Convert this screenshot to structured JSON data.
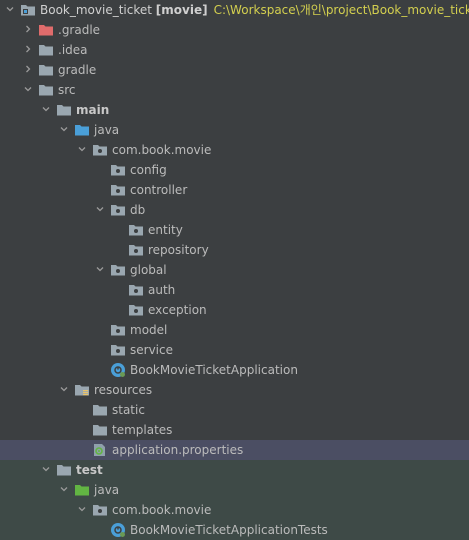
{
  "root": {
    "name": "Book_movie_ticket",
    "module": "[movie]",
    "path": "C:\\Workspace\\개인\\project\\Book_movie_ticket"
  },
  "items": [
    {
      "label": ".gradle",
      "level": 1,
      "chevron": "right",
      "icon": "folder-red-icon"
    },
    {
      "label": ".idea",
      "level": 1,
      "chevron": "right",
      "icon": "folder-icon"
    },
    {
      "label": "gradle",
      "level": 1,
      "chevron": "right",
      "icon": "folder-icon"
    },
    {
      "label": "src",
      "level": 1,
      "chevron": "down",
      "icon": "folder-icon"
    },
    {
      "label": "main",
      "level": 2,
      "chevron": "down",
      "icon": "folder-icon",
      "bold": true
    },
    {
      "label": "java",
      "level": 3,
      "chevron": "down",
      "icon": "source-folder-icon"
    },
    {
      "label": "com.book.movie",
      "level": 4,
      "chevron": "down",
      "icon": "package-icon"
    },
    {
      "label": "config",
      "level": 5,
      "chevron": "none",
      "icon": "package-icon"
    },
    {
      "label": "controller",
      "level": 5,
      "chevron": "none",
      "icon": "package-icon"
    },
    {
      "label": "db",
      "level": 5,
      "chevron": "down",
      "icon": "package-icon"
    },
    {
      "label": "entity",
      "level": 6,
      "chevron": "none",
      "icon": "package-icon"
    },
    {
      "label": "repository",
      "level": 6,
      "chevron": "none",
      "icon": "package-icon"
    },
    {
      "label": "global",
      "level": 5,
      "chevron": "down",
      "icon": "package-icon"
    },
    {
      "label": "auth",
      "level": 6,
      "chevron": "none",
      "icon": "package-icon"
    },
    {
      "label": "exception",
      "level": 6,
      "chevron": "none",
      "icon": "package-icon"
    },
    {
      "label": "model",
      "level": 5,
      "chevron": "none",
      "icon": "package-icon"
    },
    {
      "label": "service",
      "level": 5,
      "chevron": "none",
      "icon": "package-icon"
    },
    {
      "label": "BookMovieTicketApplication",
      "level": 5,
      "chevron": "none",
      "icon": "spring-class-icon"
    },
    {
      "label": "resources",
      "level": 3,
      "chevron": "down",
      "icon": "resources-folder-icon"
    },
    {
      "label": "static",
      "level": 4,
      "chevron": "none",
      "icon": "folder-icon"
    },
    {
      "label": "templates",
      "level": 4,
      "chevron": "none",
      "icon": "folder-icon"
    },
    {
      "label": "application.properties",
      "level": 4,
      "chevron": "none",
      "icon": "properties-icon",
      "selected": true
    },
    {
      "label": "test",
      "level": 2,
      "chevron": "down",
      "icon": "folder-icon",
      "bold": true,
      "tested": true
    },
    {
      "label": "java",
      "level": 3,
      "chevron": "down",
      "icon": "test-folder-icon",
      "tested": true
    },
    {
      "label": "com.book.movie",
      "level": 4,
      "chevron": "down",
      "icon": "package-icon",
      "tested": true
    },
    {
      "label": "BookMovieTicketApplicationTests",
      "level": 5,
      "chevron": "none",
      "icon": "spring-class-icon",
      "tested": true
    }
  ],
  "colors": {
    "background": "#3c3f41",
    "selected": "#4b4e63",
    "test_area": "#3e4a47",
    "path": "#d3cf4f",
    "folder": "#9aa7b0",
    "folder_red": "#e06c6c",
    "source_folder": "#4a9fd8",
    "test_folder": "#62b543",
    "spring": "#4a9fd8"
  }
}
